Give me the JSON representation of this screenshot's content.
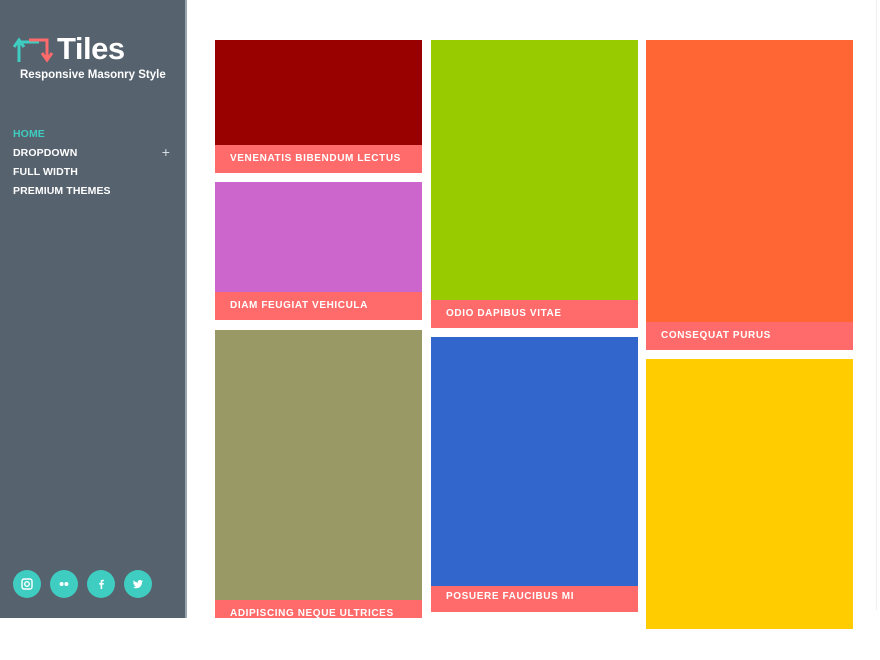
{
  "brand": {
    "title": "Tiles",
    "tagline": "Responsive Masonry Style",
    "accent_color": "#3ecdc0",
    "logo_arrow_colors": [
      "#3ecdc0",
      "#ff6b6b"
    ]
  },
  "sidebar": {
    "background": "#56626e",
    "nav": [
      {
        "label": "HOME",
        "active": true
      },
      {
        "label": "DROPDOWN",
        "active": false,
        "expand_icon": "+"
      },
      {
        "label": "FULL WIDTH",
        "active": false
      },
      {
        "label": "PREMIUM THEMES",
        "active": false
      }
    ],
    "social": [
      {
        "icon": "instagram-icon"
      },
      {
        "icon": "flickr-icon"
      },
      {
        "icon": "facebook-icon"
      },
      {
        "icon": "twitter-icon"
      }
    ]
  },
  "tiles": [
    {
      "label": "VENENATIS BIBENDUM LECTUS",
      "color": "#990000"
    },
    {
      "label": "DIAM FEUGIAT VEHICULA",
      "color": "#cc66cc"
    },
    {
      "label": "ADIPISCING NEQUE ULTRICES",
      "color": "#999966"
    },
    {
      "label": "ODIO DAPIBUS VITAE",
      "color": "#99cc00"
    },
    {
      "label": "POSUERE FAUCIBUS MI",
      "color": "#3366cc"
    },
    {
      "label": "CONSEQUAT PURUS",
      "color": "#ff6633"
    },
    {
      "label": "",
      "color": "#ffcc00"
    }
  ],
  "label_bar_color": "#ff6b6b"
}
